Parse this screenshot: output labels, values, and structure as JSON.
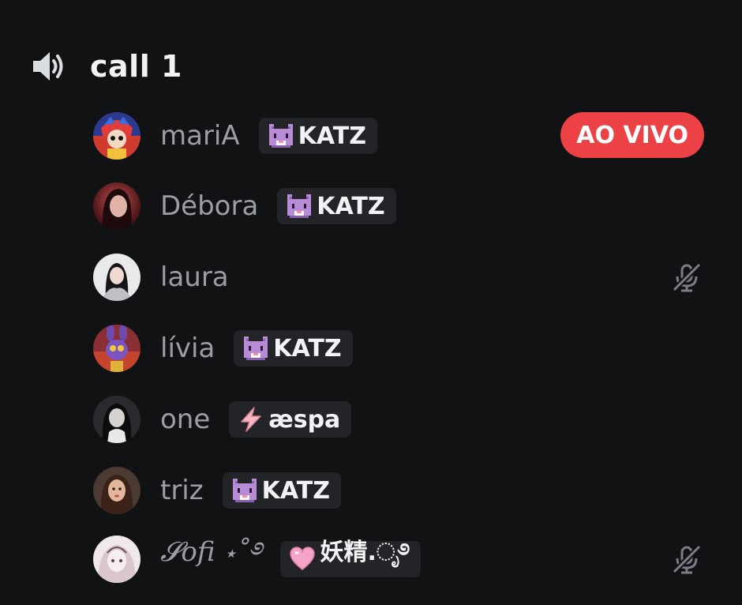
{
  "channel": {
    "name": "call 1",
    "icon": "speaker-icon"
  },
  "members": [
    {
      "name": "mariA",
      "tag": "KATZ",
      "tag_icon": "cat-icon",
      "status": "AO VIVO",
      "avatar": "avatar-pomni"
    },
    {
      "name": "Débora",
      "tag": "KATZ",
      "tag_icon": "cat-icon",
      "avatar": "avatar-photo-red"
    },
    {
      "name": "laura",
      "muted": true,
      "mute_icon": "mic-muted-icon",
      "avatar": "avatar-photo-light"
    },
    {
      "name": "lívia",
      "tag": "KATZ",
      "tag_icon": "cat-icon",
      "avatar": "avatar-jax"
    },
    {
      "name": "one",
      "tag": "æspa",
      "tag_icon": "lightning-icon",
      "avatar": "avatar-photo-dark"
    },
    {
      "name": "triz",
      "tag": "KATZ",
      "tag_icon": "cat-icon",
      "avatar": "avatar-photo-warm"
    },
    {
      "name": "𝓢ofi ⋆˚࿔",
      "tag": "妖精.ೃ࿔",
      "tag_icon": "pink-heart-icon",
      "muted": true,
      "mute_icon": "mic-muted-icon",
      "avatar": "avatar-photo-pale"
    }
  ],
  "colors": {
    "background": "#111214",
    "live": "#ed4245",
    "tag_bg": "#232428",
    "username": "#9b9ea5"
  }
}
